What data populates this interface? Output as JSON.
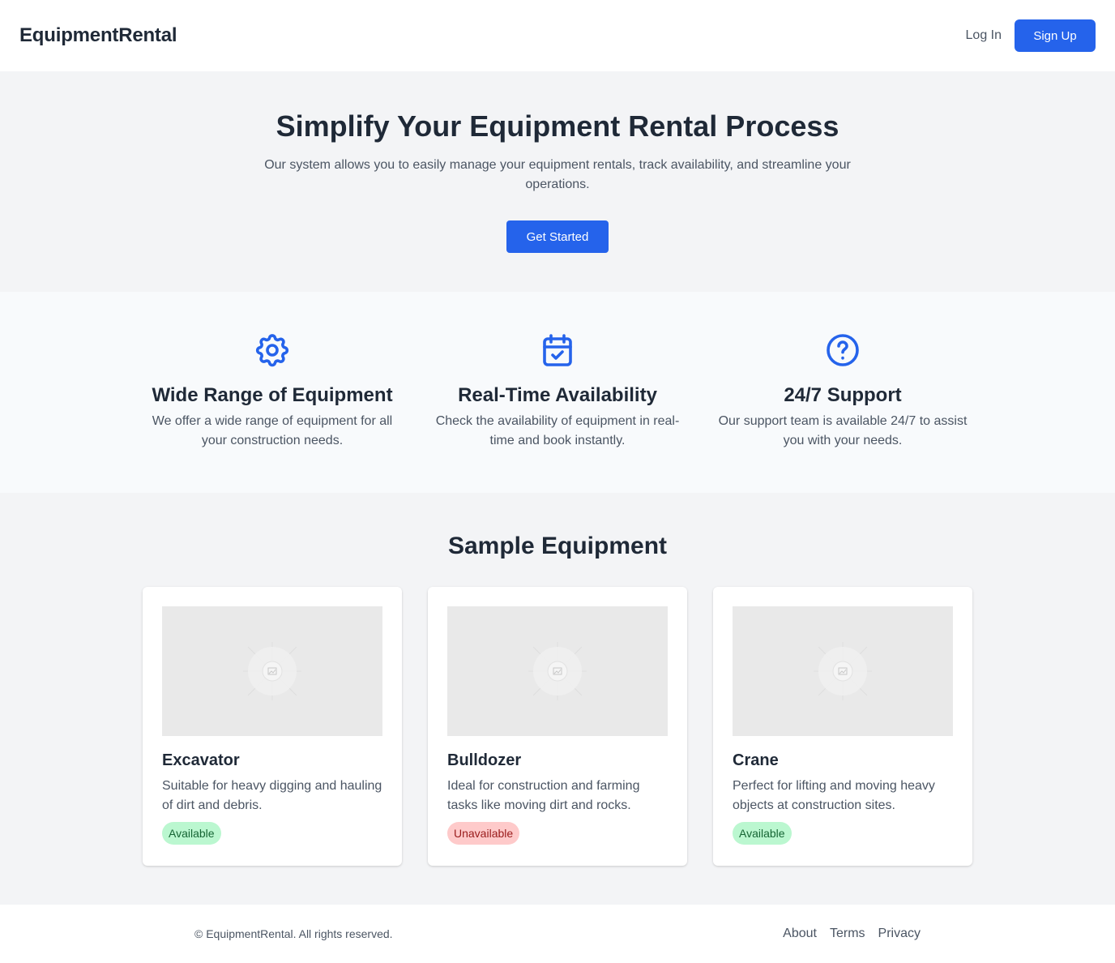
{
  "header": {
    "brand": "EquipmentRental",
    "login_label": "Log In",
    "signup_label": "Sign Up"
  },
  "hero": {
    "title": "Simplify Your Equipment Rental Process",
    "subtitle": "Our system allows you to easily manage your equipment rentals, track availability, and streamline your operations.",
    "cta_label": "Get Started"
  },
  "features": [
    {
      "icon": "gear-icon",
      "title": "Wide Range of Equipment",
      "text": "We offer a wide range of equipment for all your construction needs."
    },
    {
      "icon": "calendar-check-icon",
      "title": "Real-Time Availability",
      "text": "Check the availability of equipment in real-time and book instantly."
    },
    {
      "icon": "question-circle-icon",
      "title": "24/7 Support",
      "text": "Our support team is available 24/7 to assist you with your needs."
    }
  ],
  "samples": {
    "title": "Sample Equipment",
    "items": [
      {
        "name": "Excavator",
        "description": "Suitable for heavy digging and hauling of dirt and debris.",
        "status": "Available"
      },
      {
        "name": "Bulldozer",
        "description": "Ideal for construction and farming tasks like moving dirt and rocks.",
        "status": "Unavailable"
      },
      {
        "name": "Crane",
        "description": "Perfect for lifting and moving heavy objects at construction sites.",
        "status": "Available"
      }
    ]
  },
  "footer": {
    "copyright": "© EquipmentRental. All rights reserved.",
    "links": [
      "About",
      "Terms",
      "Privacy"
    ]
  },
  "colors": {
    "accent": "#2563eb",
    "available_bg": "#bbf7d0",
    "unavailable_bg": "#fecaca"
  }
}
